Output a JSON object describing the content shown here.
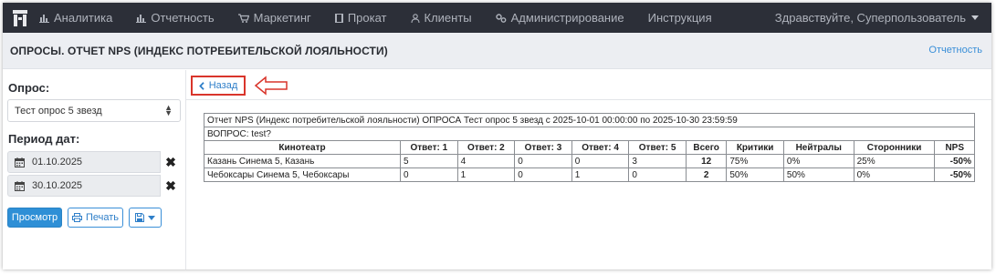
{
  "nav": {
    "items": [
      {
        "label": "Аналитика",
        "icon": "bar-chart-icon"
      },
      {
        "label": "Отчетность",
        "icon": "bar-chart-icon"
      },
      {
        "label": "Маркетинг",
        "icon": "cart-icon"
      },
      {
        "label": "Прокат",
        "icon": "film-icon"
      },
      {
        "label": "Клиенты",
        "icon": "user-icon"
      },
      {
        "label": "Администрирование",
        "icon": "cogs-icon"
      },
      {
        "label": "Инструкция",
        "icon": ""
      }
    ],
    "greeting": "Здравствуйте, Суперпользователь"
  },
  "header": {
    "title": "ОПРОСЫ. ОТЧЕТ NPS (ИНДЕКС ПОТРЕБИТЕЛЬСКОЙ ЛОЯЛЬНОСТИ)",
    "breadcrumb_link": "Отчетность"
  },
  "sidebar": {
    "survey_label": "Опрос:",
    "survey_value": "Тест опрос 5 звезд",
    "period_label": "Период дат:",
    "date_from": "01.10.2025",
    "date_to": "30.10.2025",
    "view_button": "Просмотр",
    "print_button": "Печать"
  },
  "main": {
    "back_button": "Назад"
  },
  "report": {
    "title_row": "Отчет NPS (Индекс потребительской лояльности) ОПРОСА Тест опрос 5 звезд с 2025-10-01 00:00:00 по 2025-10-30 23:59:59",
    "question_row": "ВОПРОС: test?",
    "headers": [
      "Кинотеатр",
      "Ответ: 1",
      "Ответ: 2",
      "Ответ: 3",
      "Ответ: 4",
      "Ответ: 5",
      "Всего",
      "Критики",
      "Нейтралы",
      "Сторонники",
      "NPS"
    ],
    "rows": [
      [
        "Казань Синема 5, Казань",
        "5",
        "4",
        "0",
        "0",
        "3",
        "12",
        "75%",
        "0%",
        "25%",
        "-50%"
      ],
      [
        "Чебоксары Синема 5, Чебоксары",
        "0",
        "1",
        "0",
        "1",
        "0",
        "2",
        "50%",
        "50%",
        "0%",
        "-50%"
      ]
    ]
  },
  "colors": {
    "nav_bg": "#2c2f38",
    "accent": "#2e8fd6",
    "annotation_red": "#d9352b"
  }
}
